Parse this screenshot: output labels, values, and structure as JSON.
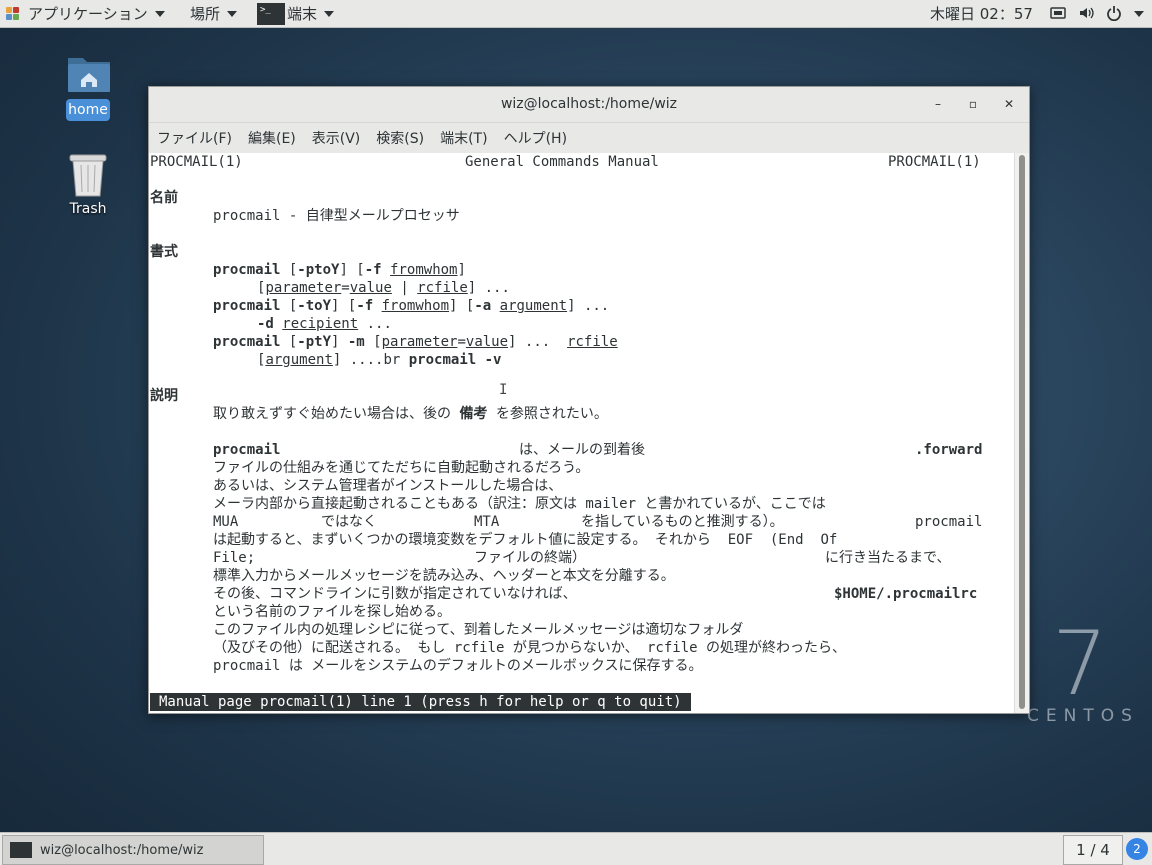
{
  "top_panel": {
    "applications": "アプリケーション",
    "places": "場所",
    "active_app": "端末",
    "clock": "木曜日 02：57"
  },
  "desktop": {
    "home_label": "home",
    "trash_label": "Trash",
    "watermark_number": "7",
    "watermark_text": "CENTOS"
  },
  "window": {
    "title": "wiz@localhost:/home/wiz",
    "minimize": "–",
    "maximize": "▫",
    "close": "✕",
    "menu": [
      "ファイル(F)",
      "編集(E)",
      "表示(V)",
      "検索(S)",
      "端末(T)",
      "ヘルプ(H)"
    ]
  },
  "man": {
    "header_left": "PROCMAIL(1)",
    "header_center": "General Commands Manual",
    "header_right": "PROCMAIL(1)",
    "sec_name": "名前",
    "name_line": "procmail - 自律型メールプロセッサ",
    "sec_synopsis": "書式",
    "syn": {
      "procmail": "procmail",
      "opt_ptoY": "-ptoY",
      "opt_f": "-f",
      "fromwhom": "fromwhom",
      "parameter": "parameter",
      "value": "value",
      "rcfile": "rcfile",
      "opt_toY": "-toY",
      "opt_a": "-a",
      "argument": "argument",
      "opt_d": "-d",
      "recipient": "recipient",
      "opt_ptY": "-ptY",
      "opt_m": "-m",
      "br_text": "....br",
      "opt_v": "-v",
      "ellipsis": "..."
    },
    "sec_desc": "説明",
    "desc_intro_a": "取り敢えずすぐ始めたい場合は、後の",
    "desc_intro_b": "備考",
    "desc_intro_c": "を参照されたい。",
    "d1a": "procmail",
    "d1b": "は、メールの到着後",
    "d1c": ".forward",
    "d2": "ファイルの仕組みを通じてただちに自動起動されるだろう。",
    "d3": "あるいは、システム管理者がインストールした場合は、",
    "d4": "メーラ内部から直接起動されることもある（訳注：原文は mailer と書かれているが、ここでは",
    "d5a": "MUA",
    "d5b": "ではなく",
    "d5c": "MTA",
    "d5d": "を指しているものと推測する）。",
    "d5e": "procmail",
    "d6": "は起動すると、まずいくつかの環境変数をデフォルト値に設定する。 それから  EOF  (End  Of",
    "d7a": "File;",
    "d7b": "ファイルの終端）",
    "d7c": "に行き当たるまで、",
    "d8": "標準入力からメールメッセージを読み込み、ヘッダーと本文を分離する。",
    "d9a": "その後、コマンドラインに引数が指定されていなければ、",
    "d9b": "$HOME/.procmailrc",
    "d10": "という名前のファイルを探し始める。",
    "d11": "このファイル内の処理レシピに従って、到着したメールメッセージは適切なフォルダ",
    "d12": "（及びその他）に配送される。 もし rcfile が見つからないか、 rcfile の処理が終わったら、",
    "d13": "procmail は メールをシステムのデフォルトのメールボックスに保存する。",
    "status": "Manual page procmail(1) line 1 (press h for help or q to quit)"
  },
  "bottom_panel": {
    "task_title": "wiz@localhost:/home/wiz",
    "workspace": "1 / 4",
    "notification_count": "2"
  }
}
